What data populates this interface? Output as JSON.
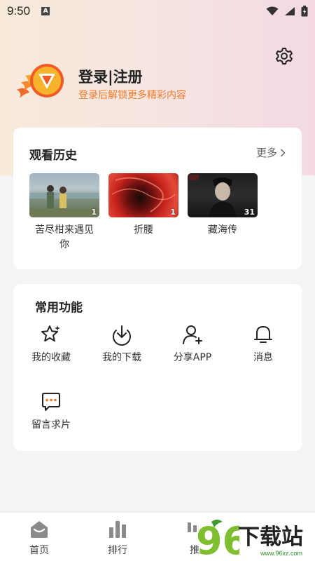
{
  "status_bar": {
    "time": "9:50",
    "notification_letter": "A"
  },
  "header": {
    "login_title": "登录|注册",
    "login_subtitle": "登录后解锁更多精彩内容",
    "settings_icon": "gear-icon",
    "colors": {
      "accent_orange": "#ef7b2a"
    }
  },
  "history": {
    "title": "观看历史",
    "more_label": "更多",
    "items": [
      {
        "title": "苦尽柑来遇见你",
        "count": "1"
      },
      {
        "title": "折腰",
        "count": "1"
      },
      {
        "title": "藏海传",
        "count": "31"
      }
    ]
  },
  "functions": {
    "title": "常用功能",
    "items": [
      {
        "label": "我的收藏",
        "icon": "star-icon"
      },
      {
        "label": "我的下载",
        "icon": "download-icon"
      },
      {
        "label": "分享APP",
        "icon": "share-user-icon"
      },
      {
        "label": "消息",
        "icon": "bell-icon"
      },
      {
        "label": "留言求片",
        "icon": "message-icon"
      }
    ]
  },
  "bottom_nav": {
    "items": [
      {
        "label": "首页",
        "icon": "home-icon"
      },
      {
        "label": "排行",
        "icon": "ranking-icon"
      },
      {
        "label": "推",
        "icon": "recommend-icon"
      }
    ]
  },
  "watermark": {
    "logo_text": "96",
    "text": "下载站",
    "url": "www.96xz.com"
  }
}
